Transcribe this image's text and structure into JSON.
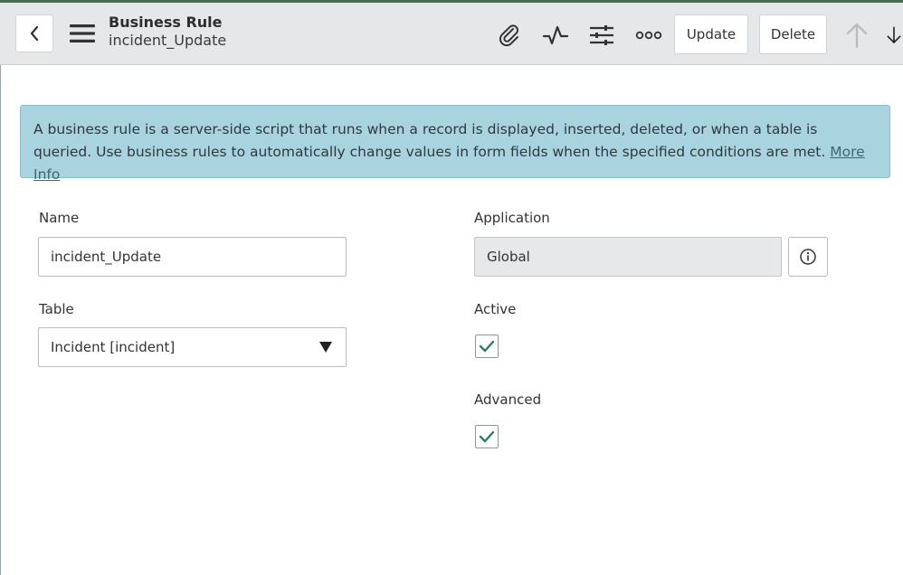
{
  "header": {
    "title": "Business Rule",
    "subtitle": "incident_Update",
    "update_label": "Update",
    "delete_label": "Delete"
  },
  "info": {
    "text": "A business rule is a server-side script that runs when a record is displayed, inserted, deleted, or when a table is queried. Use business rules to automatically change values in form fields when the specified conditions are met.",
    "link_label": "More Info"
  },
  "form": {
    "name_label": "Name",
    "name_value": "incident_Update",
    "table_label": "Table",
    "table_value": "Incident [incident]",
    "application_label": "Application",
    "application_value": "Global",
    "active_label": "Active",
    "active_checked": true,
    "advanced_label": "Advanced",
    "advanced_checked": true
  },
  "colors": {
    "info_bg": "#a9d3de",
    "check": "#2e7d6b",
    "header_bg": "#e5e7e8"
  }
}
